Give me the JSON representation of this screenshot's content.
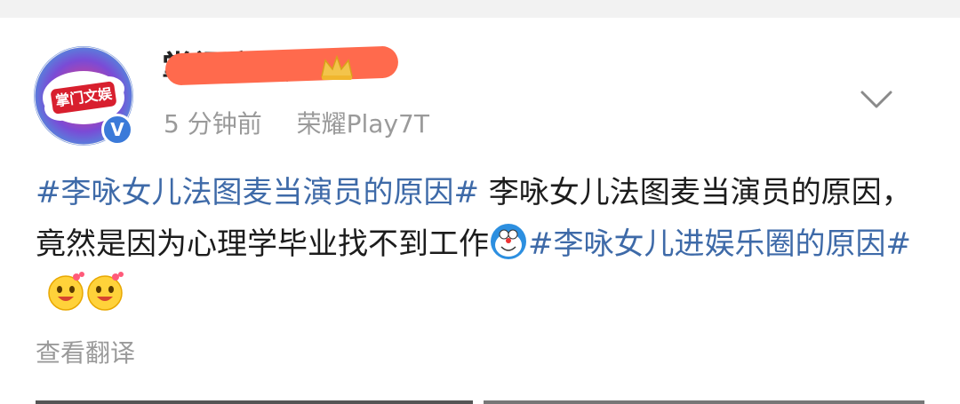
{
  "avatar": {
    "text": "掌门文娱"
  },
  "user": {
    "name_visible": "掌门文娱"
  },
  "meta": {
    "time": "5 分钟前",
    "device": "荣耀Play7T"
  },
  "post": {
    "tag1": "#李咏女儿法图麦当演员的原因#",
    "text1": " 李咏女儿法图麦当演员的原因，竟然是因为心理学毕业找不到工作",
    "tag2": "#李咏女儿进娱乐圈的原因#"
  },
  "translate_label": "查看翻译",
  "colors": {
    "tag": "#3e6aa8",
    "verified": "#3b7ad9",
    "redaction": "#ff6a4d"
  },
  "icons": {
    "verified": "verified-v-icon",
    "crown": "crown-icon",
    "chevron": "chevron-down-icon"
  }
}
